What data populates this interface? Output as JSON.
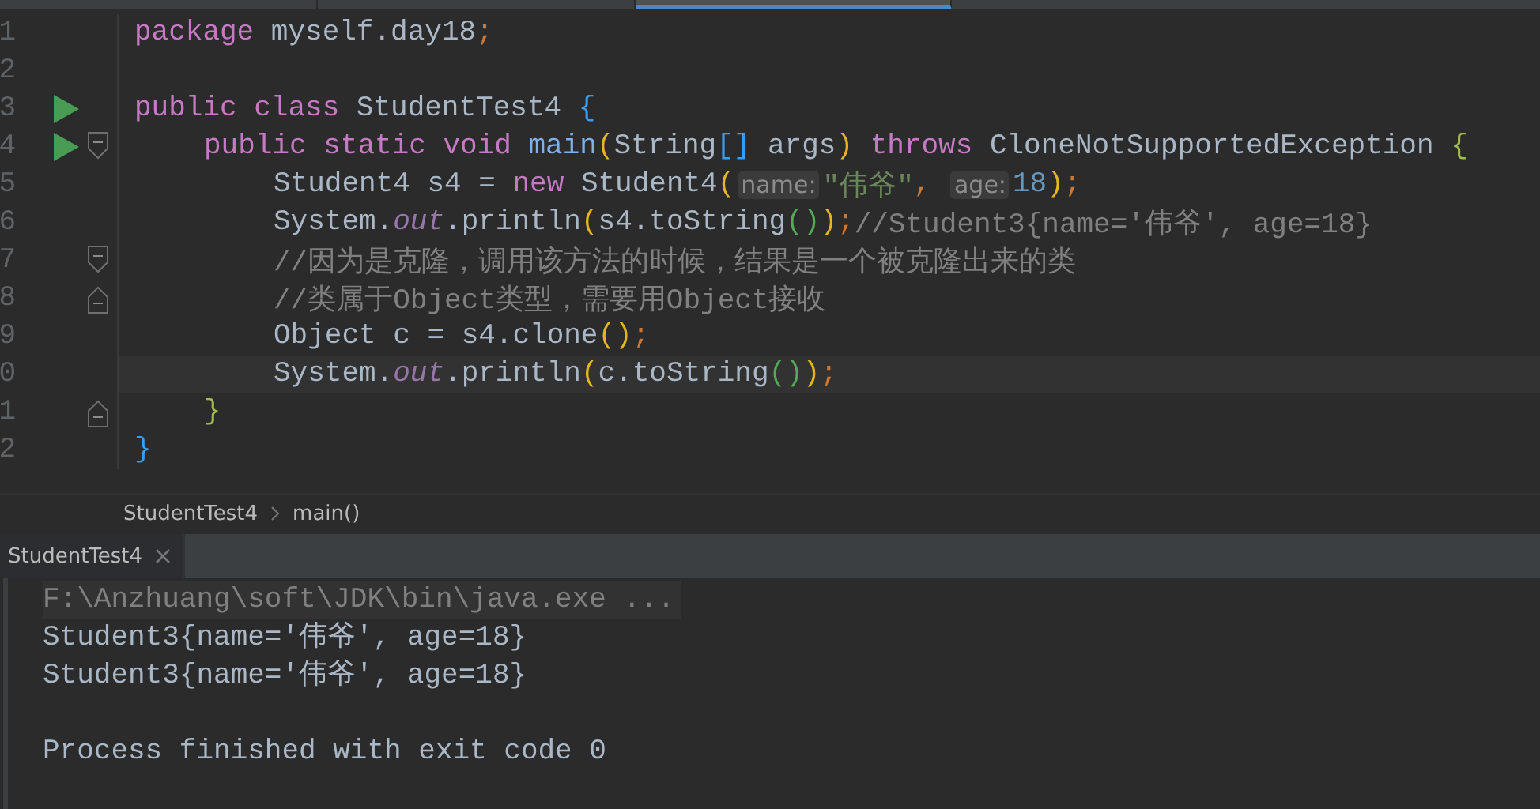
{
  "editor_tabs": [
    {
      "selected": false
    },
    {
      "selected": false
    },
    {
      "selected": true
    }
  ],
  "editor": {
    "lines": [
      {
        "number": "1",
        "tokens": [
          {
            "text": "package",
            "kind": "keyword"
          },
          {
            "text": " myself.day18",
            "kind": "plain"
          },
          {
            "text": ";",
            "kind": "punct"
          }
        ]
      },
      {
        "number": "2"
      },
      {
        "number": "3",
        "run": true,
        "tokens": [
          {
            "text": "public class",
            "kind": "keyword"
          },
          {
            "text": " StudentTest4 ",
            "kind": "plain"
          },
          {
            "text": "{",
            "kind": "brace"
          }
        ],
        "children": [
          {
            "number": "4",
            "run": true,
            "fold_start": true,
            "tokens": [
              {
                "text": "public static void",
                "kind": "keyword"
              },
              {
                "text": " main",
                "kind": "decl"
              },
              {
                "text": "(",
                "kind": "paren"
              },
              {
                "text": "String",
                "kind": "plain"
              },
              {
                "text": "[]",
                "kind": "brace"
              },
              {
                "text": " args",
                "kind": "plain"
              },
              {
                "text": ")",
                "kind": "paren"
              },
              {
                "text": " throws",
                "kind": "keyword"
              },
              {
                "text": " CloneNotSupportedException ",
                "kind": "plain"
              },
              {
                "text": "{",
                "kind": "brace2"
              }
            ],
            "children": [
              {
                "number": "5",
                "tokens": [
                  {
                    "text": "Student4 s4 = ",
                    "kind": "plain"
                  },
                  {
                    "text": "new",
                    "kind": "keyword"
                  },
                  {
                    "text": " Student4",
                    "kind": "plain"
                  },
                  {
                    "text": "(",
                    "kind": "paren"
                  },
                  {
                    "text": "name:",
                    "kind": "hint"
                  },
                  {
                    "text": "\"伟爷\"",
                    "kind": "string"
                  },
                  {
                    "text": ", ",
                    "kind": "punct"
                  },
                  {
                    "text": "age:",
                    "kind": "hint"
                  },
                  {
                    "text": "18",
                    "kind": "number"
                  },
                  {
                    "text": ")",
                    "kind": "paren"
                  },
                  {
                    "text": ";",
                    "kind": "punct"
                  }
                ]
              },
              {
                "number": "6",
                "tokens": [
                  {
                    "text": "System.",
                    "kind": "plain"
                  },
                  {
                    "text": "out",
                    "kind": "field"
                  },
                  {
                    "text": ".println",
                    "kind": "plain"
                  },
                  {
                    "text": "(",
                    "kind": "paren"
                  },
                  {
                    "text": "s4.toString",
                    "kind": "plain"
                  },
                  {
                    "text": "()",
                    "kind": "paren2"
                  },
                  {
                    "text": ")",
                    "kind": "paren"
                  },
                  {
                    "text": ";",
                    "kind": "punct"
                  },
                  {
                    "text": "//Student3{name='伟爷', age=18}",
                    "kind": "comment"
                  }
                ]
              },
              {
                "number": "7",
                "fold_start": true,
                "tokens": [
                  {
                    "text": "//因为是克隆，调用该方法的时候，结果是一个被克隆出来的类",
                    "kind": "comment"
                  }
                ]
              },
              {
                "number": "8",
                "fold_end": true,
                "tokens": [
                  {
                    "text": "//类属于Object类型，需要用Object接收",
                    "kind": "comment"
                  }
                ]
              },
              {
                "number": "9",
                "tokens": [
                  {
                    "text": "Object c = s4.clone",
                    "kind": "plain"
                  },
                  {
                    "text": "()",
                    "kind": "paren"
                  },
                  {
                    "text": ";",
                    "kind": "punct"
                  }
                ]
              },
              {
                "number": "0",
                "current": true,
                "tokens": [
                  {
                    "text": "System.",
                    "kind": "plain"
                  },
                  {
                    "text": "out",
                    "kind": "field"
                  },
                  {
                    "text": ".println",
                    "kind": "plain"
                  },
                  {
                    "text": "(",
                    "kind": "paren"
                  },
                  {
                    "text": "c.toString",
                    "kind": "plain"
                  },
                  {
                    "text": "()",
                    "kind": "paren2"
                  },
                  {
                    "text": ")",
                    "kind": "paren"
                  },
                  {
                    "text": ";",
                    "kind": "punct"
                  }
                ]
              }
            ]
          },
          {
            "number": "1",
            "fold_end": true,
            "tokens": [
              {
                "text": "}",
                "kind": "brace2"
              }
            ]
          }
        ]
      },
      {
        "number": "2",
        "tokens": [
          {
            "text": "}",
            "kind": "brace"
          }
        ]
      }
    ]
  },
  "breadcrumb": [
    "StudentTest4",
    "main()"
  ],
  "run_panel": {
    "tab": {
      "label": "StudentTest4",
      "selected": true
    },
    "lines": [
      {
        "text": "F:\\Anzhuang\\soft\\JDK\\bin\\java.exe ...",
        "kind": "command"
      },
      {
        "text": "Student3{name='伟爷', age=18}",
        "kind": "output"
      },
      {
        "text": "Student3{name='伟爷', age=18}",
        "kind": "output"
      },
      {
        "text": "Process finished with exit code 0",
        "kind": "status"
      }
    ]
  }
}
